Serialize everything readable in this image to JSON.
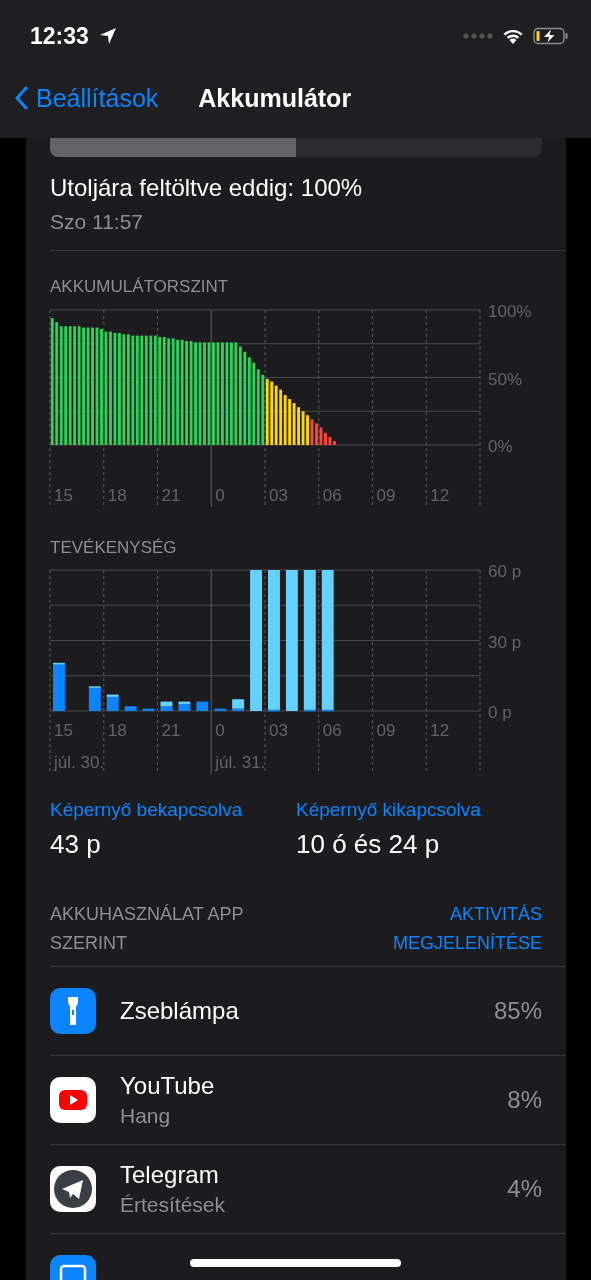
{
  "status_bar": {
    "time": "12:33"
  },
  "nav": {
    "back": "Beállítások",
    "title": "Akkumulátor"
  },
  "segments": [
    {
      "selected": true
    },
    {
      "selected": false
    }
  ],
  "last_charged": {
    "text": "Utoljára feltöltve eddig: 100%",
    "time": "Szo 11:57"
  },
  "battery_level": {
    "title": "AKKUMULÁTORSZINT",
    "chart_data": {
      "type": "bar",
      "ylim": [
        0,
        100
      ],
      "categories": [
        null,
        null,
        null,
        "15",
        null,
        null,
        null,
        null,
        null,
        null,
        null,
        null,
        null,
        null,
        null,
        "18",
        null,
        null,
        null,
        null,
        null,
        null,
        null,
        null,
        null,
        null,
        null,
        "21",
        null,
        null,
        null,
        null,
        null,
        null,
        null,
        null,
        null,
        null,
        null,
        "0",
        null,
        null,
        null,
        null,
        null,
        null,
        null,
        null,
        null,
        null,
        null,
        "03",
        null,
        null,
        null,
        null,
        null,
        null,
        null,
        null,
        null,
        null,
        null,
        "06",
        null,
        null,
        null,
        null,
        null,
        null,
        null,
        null,
        null,
        null,
        null,
        "09",
        null,
        null,
        null,
        null,
        null,
        null,
        null,
        null,
        null,
        null,
        null,
        "12",
        null,
        null,
        null,
        null,
        null,
        null,
        null,
        null
      ],
      "yticks": [
        {
          "value": 0,
          "label": "0%"
        },
        {
          "value": 50,
          "label": "50%"
        },
        {
          "value": 100,
          "label": "100%"
        }
      ],
      "series": [
        {
          "color": "#30d158",
          "values": [
            94,
            91,
            88,
            88,
            88,
            88,
            88,
            87,
            87,
            87,
            87,
            86,
            84,
            84,
            83,
            83,
            82,
            82,
            81,
            81,
            81,
            81,
            81,
            81,
            80,
            80,
            79,
            79,
            78,
            78,
            77,
            77,
            76,
            76,
            76,
            76,
            76,
            76,
            76,
            76,
            76,
            76,
            73,
            69,
            65,
            61,
            56,
            52,
            null,
            null,
            null,
            null,
            null,
            null,
            null,
            null,
            null,
            null,
            null,
            null,
            null,
            null,
            null,
            null,
            null,
            null,
            null,
            null,
            null,
            null,
            null,
            null,
            null,
            null,
            null,
            null,
            null,
            null,
            null,
            null,
            null,
            null,
            null,
            null,
            null,
            null,
            null,
            null,
            null,
            null,
            null,
            null,
            null,
            null,
            null,
            null
          ]
        },
        {
          "color": "#ffd60a",
          "values": [
            null,
            null,
            null,
            null,
            null,
            null,
            null,
            null,
            null,
            null,
            null,
            null,
            null,
            null,
            null,
            null,
            null,
            null,
            null,
            null,
            null,
            null,
            null,
            null,
            null,
            null,
            null,
            null,
            null,
            null,
            null,
            null,
            null,
            null,
            null,
            null,
            null,
            null,
            null,
            null,
            null,
            null,
            null,
            null,
            null,
            null,
            null,
            null,
            49,
            47,
            44,
            41,
            37,
            34,
            31,
            28,
            25,
            22,
            null,
            null,
            null,
            null,
            null,
            null,
            null,
            null,
            null,
            null,
            null,
            null,
            null,
            null,
            null,
            null,
            null,
            null,
            null,
            null,
            null,
            null,
            null,
            null,
            null,
            null,
            null,
            null,
            null,
            null,
            null,
            null,
            null,
            null,
            null,
            null,
            null,
            null
          ]
        },
        {
          "color": "#ff453a",
          "values": [
            null,
            null,
            null,
            null,
            null,
            null,
            null,
            null,
            null,
            null,
            null,
            null,
            null,
            null,
            null,
            null,
            null,
            null,
            null,
            null,
            null,
            null,
            null,
            null,
            null,
            null,
            null,
            null,
            null,
            null,
            null,
            null,
            null,
            null,
            null,
            null,
            null,
            null,
            null,
            null,
            null,
            null,
            null,
            null,
            null,
            null,
            null,
            null,
            null,
            null,
            null,
            null,
            null,
            null,
            null,
            null,
            null,
            null,
            19,
            16,
            13,
            9,
            6,
            3,
            null,
            null,
            null,
            null,
            null,
            null,
            null,
            null,
            null,
            null,
            null,
            null,
            null,
            null,
            null,
            null,
            null,
            null,
            null,
            null,
            null,
            null,
            null,
            null,
            null,
            null,
            null,
            null,
            null,
            null,
            null,
            null
          ]
        }
      ]
    }
  },
  "activity": {
    "title": "TEVÉKENYSÉG",
    "date_labels": [
      "júl. 30.",
      "júl. 31."
    ],
    "chart_data": {
      "type": "bar",
      "stacked": true,
      "ylim": [
        0,
        60
      ],
      "categories": [
        "15",
        null,
        null,
        "18",
        null,
        null,
        "21",
        null,
        null,
        "0",
        null,
        null,
        "03",
        null,
        null,
        "06",
        null,
        null,
        "09",
        null,
        null,
        "12",
        null,
        null
      ],
      "yticks": [
        {
          "value": 0,
          "label": "0 p"
        },
        {
          "value": 30,
          "label": "30 p"
        },
        {
          "value": 60,
          "label": "60 p"
        }
      ],
      "series": [
        {
          "name": "Képernyő bekapcsolva",
          "color": "#0a84ff",
          "values": [
            20,
            null,
            10,
            6,
            2,
            1,
            2,
            3,
            4,
            1,
            1,
            null,
            0.5,
            null,
            0.5,
            0.5,
            null,
            null,
            null,
            null,
            null,
            null,
            null,
            null
          ]
        },
        {
          "name": "Képernyő kikapcsolva",
          "color": "#64d2ff",
          "values": [
            0.5,
            null,
            0.5,
            1,
            null,
            null,
            2,
            1,
            null,
            null,
            4,
            60,
            59.5,
            60,
            59.5,
            59.5,
            null,
            null,
            null,
            null,
            null,
            null,
            null,
            null
          ]
        }
      ]
    }
  },
  "screen": [
    {
      "value": "43 p"
    },
    {
      "value": "10 ó és 24 p"
    }
  ],
  "usage": {
    "title": "AKKUHASZNÁLAT APP SZERINT",
    "action": "AKTIVITÁS MEGJELENÍTÉSE"
  },
  "apps": [
    {
      "kind": "flashlight",
      "name": "Zseblámpa",
      "percent": "85%"
    },
    {
      "kind": "youtube",
      "name": "YouTube",
      "detail": "Hang",
      "percent": "8%"
    },
    {
      "kind": "telegram",
      "name": "Telegram",
      "detail": "Értesítések",
      "percent": "4%"
    },
    {
      "kind": "calendar"
    }
  ]
}
